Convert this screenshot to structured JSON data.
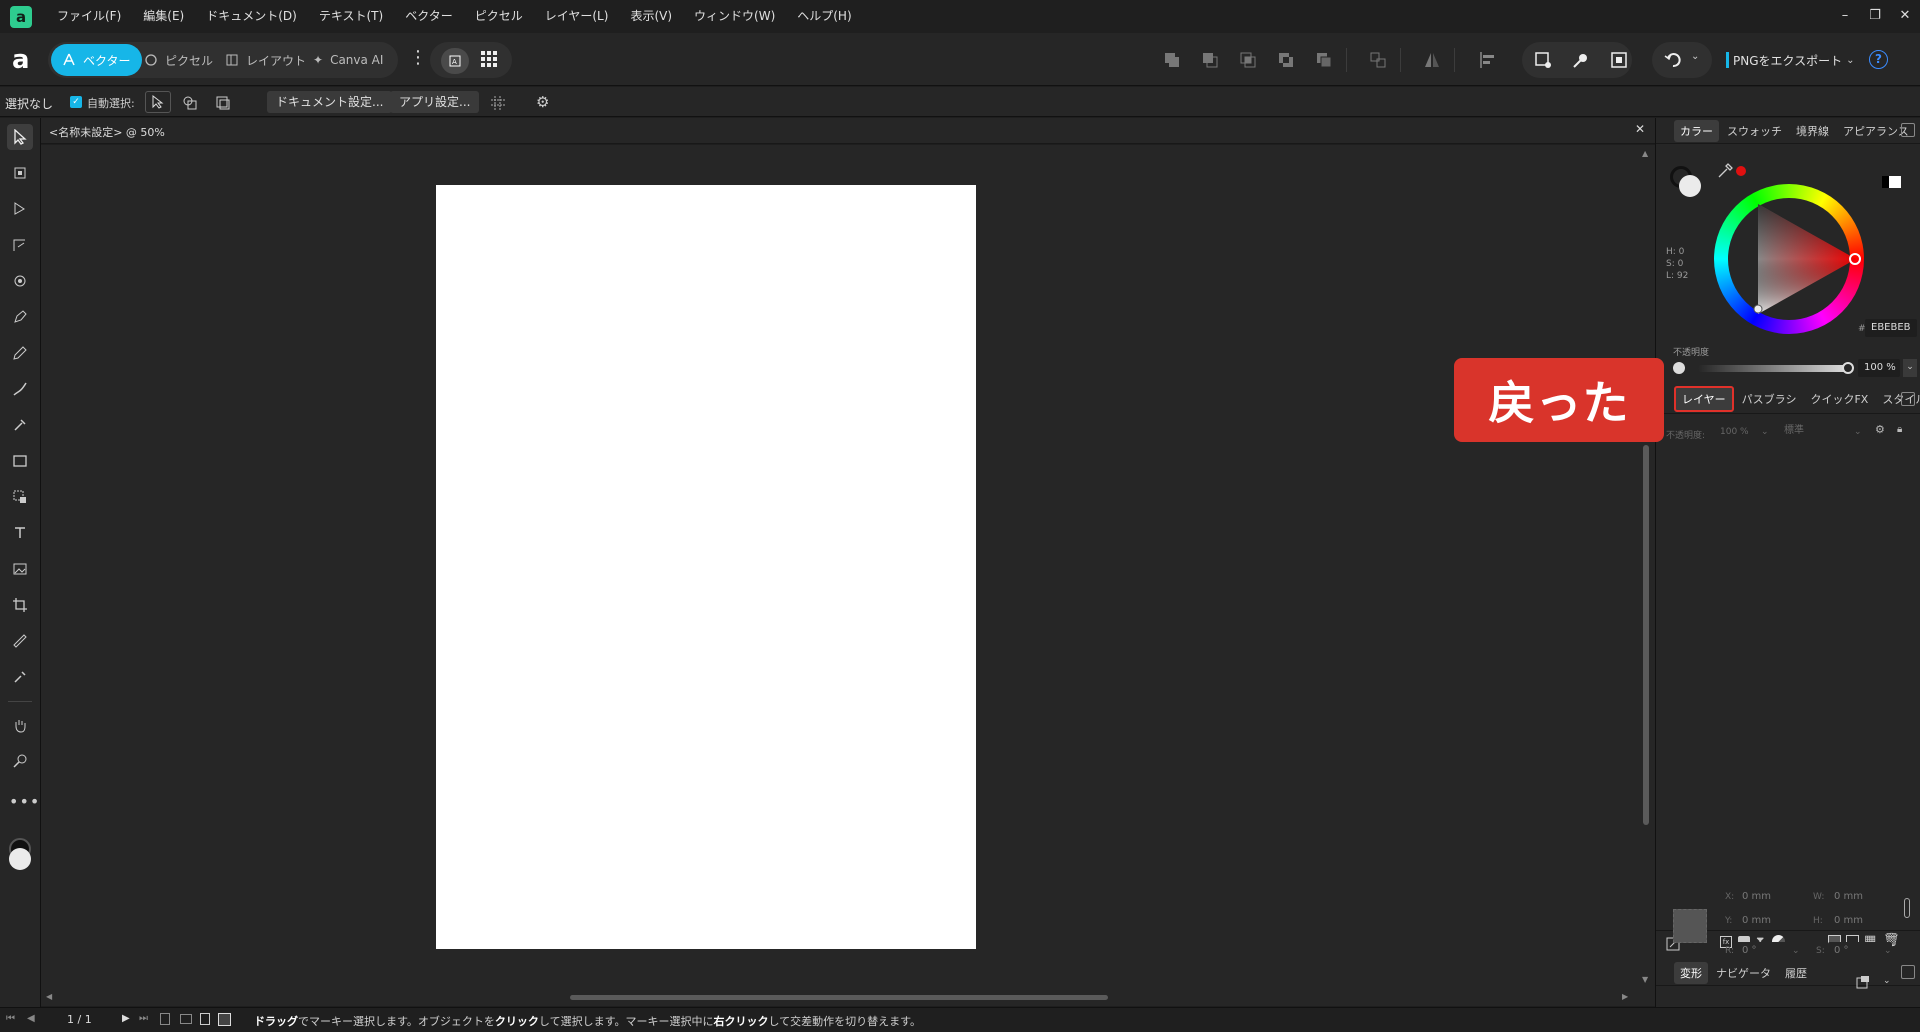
{
  "menubar": {
    "logo": "a",
    "items": [
      "ファイル(F)",
      "編集(E)",
      "ドキュメント(D)",
      "テキスト(T)",
      "ベクター",
      "ピクセル",
      "レイヤー(L)",
      "表示(V)",
      "ウィンドウ(W)",
      "ヘルプ(H)"
    ]
  },
  "toolbar": {
    "personas": [
      "ベクター",
      "ピクセル",
      "レイアウト",
      "Canva AI"
    ],
    "export_label": "PNGをエクスポート",
    "accent_color": "#16b6e8"
  },
  "context": {
    "selection": "選択なし",
    "auto_select": "自動選択:",
    "doc_settings": "ドキュメント設定...",
    "app_settings": "アプリ設定..."
  },
  "document": {
    "tab_title": "<名称未設定> @ 50%"
  },
  "color_panel": {
    "tabs": [
      "カラー",
      "スウォッチ",
      "境界線",
      "アピアランス"
    ],
    "h": "H: 0",
    "s": "S: 0",
    "l": "L: 92",
    "hex_label": "#",
    "hex": "EBEBEB",
    "opacity_label": "不透明度",
    "opacity": "100 %"
  },
  "layers_panel": {
    "tabs": [
      "レイヤー",
      "パスブラシ",
      "クイックFX",
      "スタイル"
    ],
    "opacity_label": "不透明度:",
    "opacity": "100 %",
    "blend": "標準"
  },
  "transform_panel": {
    "tabs": [
      "変形",
      "ナビゲータ",
      "履歴"
    ],
    "x_label": "X:",
    "x": "0 mm",
    "y_label": "Y:",
    "y": "0 mm",
    "w_label": "W:",
    "w": "0 mm",
    "h_label": "H:",
    "h": "0 mm",
    "r_label": "R:",
    "r": "0 °",
    "s_label": "S:",
    "s": "0 °"
  },
  "status": {
    "page": "1 / 1",
    "hint_1": "ドラッグ",
    "hint_2": "でマーキー選択します。オブジェクトを",
    "hint_3": "クリック",
    "hint_4": "して選択します。マーキー選択中に",
    "hint_5": "右クリック",
    "hint_6": "して交差動作を切り替えます。"
  },
  "callout": {
    "text": "戻った",
    "color": "#d9342b"
  }
}
